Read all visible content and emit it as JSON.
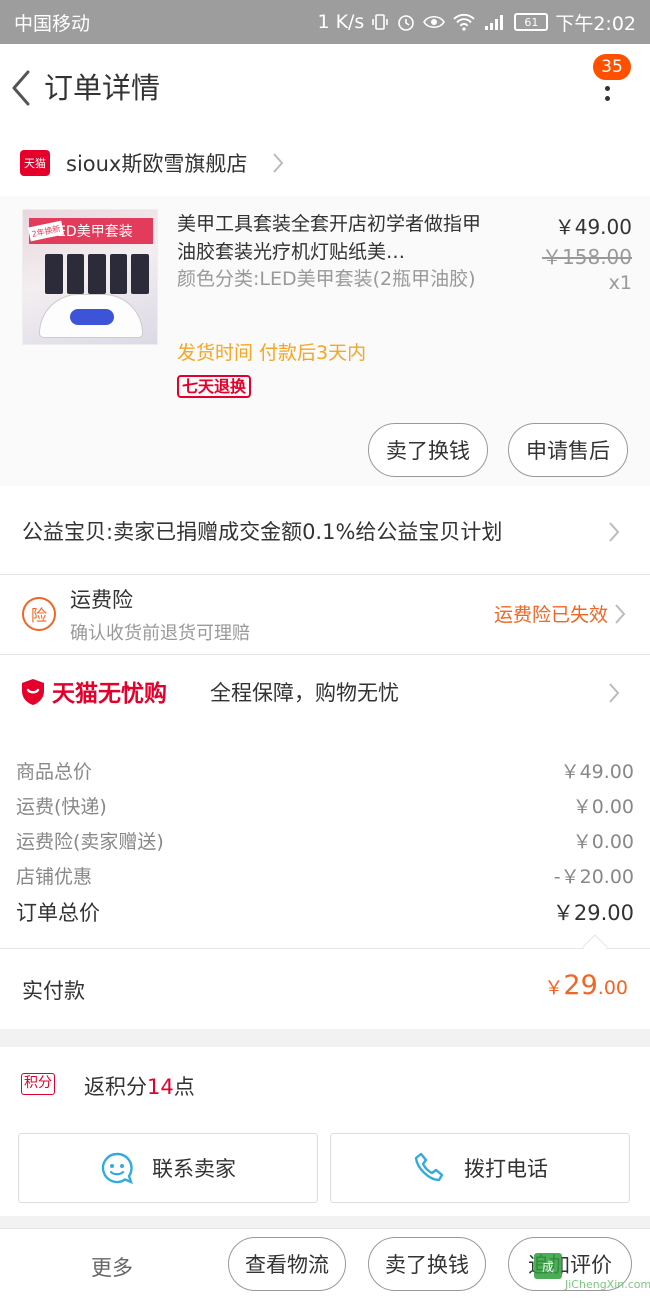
{
  "status_bar": {
    "carrier": "中国移动",
    "speed": "1 K/s",
    "battery": "61",
    "time": "下午2:02"
  },
  "nav": {
    "title": "订单详情",
    "badge_count": "35"
  },
  "shop": {
    "logo_text": "天猫",
    "name": "sioux斯欧雪旗舰店"
  },
  "item": {
    "title": "美甲工具套装全套开店初学者做指甲油胶套装光疗机灯贴纸美…",
    "sku": "颜色分类:LED美甲套装(2瓶甲油胶)",
    "price": "￥49.00",
    "original_price": "￥158.00",
    "quantity": "x1",
    "ship_time": "发货时间  付款后3天内",
    "return_badge": "七天退换",
    "thumb_tag": "LED美甲套装",
    "thumb_corner": "2年换新",
    "buttons": {
      "resell": "卖了换钱",
      "after_sale": "申请售后"
    }
  },
  "charity": {
    "text": "公益宝贝:卖家已捐赠成交金额0.1%给公益宝贝计划"
  },
  "insurance": {
    "icon_text": "险",
    "title": "运费险",
    "subtitle": "确认收货前退货可理赔",
    "status": "运费险已失效"
  },
  "guarantee": {
    "brand": "天猫无忧购",
    "desc": "全程保障，购物无忧"
  },
  "summary": {
    "rows": [
      {
        "label": "商品总价",
        "value": "￥49.00"
      },
      {
        "label": "运费(快递)",
        "value": "￥0.00"
      },
      {
        "label": "运费险(卖家赠送)",
        "value": "￥0.00"
      },
      {
        "label": "店铺优惠",
        "value": "-￥20.00"
      }
    ],
    "total_label": "订单总价",
    "total_value": "￥29.00"
  },
  "paid": {
    "label": "实付款",
    "currency": "￥",
    "integer": "29",
    "decimal": ".00"
  },
  "points": {
    "tag": "积分",
    "prefix": "返积分",
    "num": "14",
    "suffix": "点"
  },
  "contact": {
    "seller": "联系卖家",
    "phone": "拨打电话"
  },
  "bottom_bar": {
    "more": "更多",
    "logistics": "查看物流",
    "resell": "卖了换钱",
    "review": "追加评价"
  },
  "watermark": {
    "mark": "成",
    "site": "JiChengXin.com"
  },
  "colors": {
    "accent": "#ff5000",
    "tmall_red": "#e4002b",
    "orange": "#f26522",
    "gold": "#f5a623",
    "contact_blue": "#33aadd"
  }
}
